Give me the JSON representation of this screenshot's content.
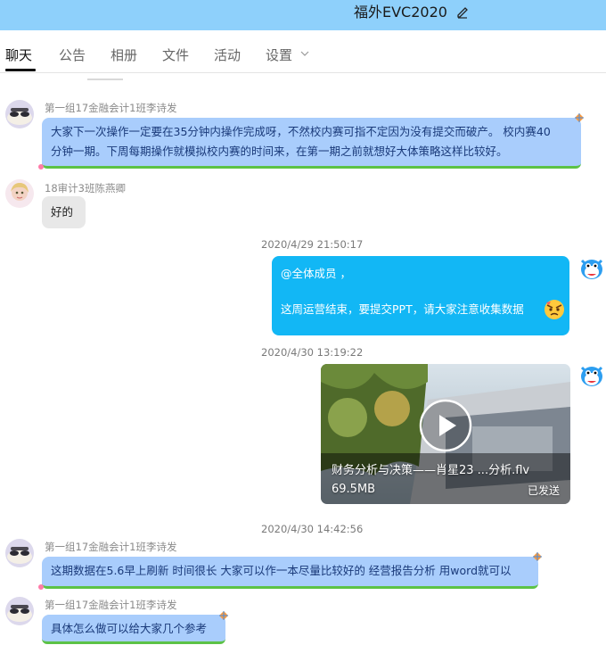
{
  "window": {
    "title": "福外EVC2020"
  },
  "tabs": [
    {
      "label": "聊天",
      "active": true
    },
    {
      "label": "公告"
    },
    {
      "label": "相册"
    },
    {
      "label": "文件"
    },
    {
      "label": "活动"
    },
    {
      "label": "设置"
    }
  ],
  "messages": {
    "m1": {
      "sender": "第一组17金融会计1班李诗发",
      "line1": "大家下一次操作一定要在35分钟内操作完成呀，不然校内赛可指不定因为没有提交而破产。 校内赛40",
      "line2": "分钟一期。下周每期操作就模拟校内赛的时间来，在第一期之前就想好大体策略这样比较好。"
    },
    "m2": {
      "sender": "18审计3班陈燕卿",
      "text": "好的"
    },
    "m3": {
      "timestamp": "2020/4/29 21:50:17",
      "line1": "@全体成员 ，",
      "line2": "这周运营结束，要提交PPT，请大家注意收集数据"
    },
    "m4": {
      "timestamp": "2020/4/30 13:19:22",
      "video_title": "财务分析与决策——肖星23 ...分析.flv",
      "video_size": "69.5MB",
      "video_status": "已发送"
    },
    "m5": {
      "timestamp": "2020/4/30 14:42:56",
      "sender": "第一组17金融会计1班李诗发",
      "text": "这期数据在5.6早上刷新 时间很长 大家可以作一本尽量比较好的 经营报告分析 用word就可以"
    },
    "m6": {
      "sender": "第一组17金融会计1班李诗发",
      "text": "具体怎么做可以给大家几个参考"
    }
  },
  "colors": {
    "titlebar": "#8ed0fb",
    "bubble_blue": "#a9cdfc",
    "bubble_self": "#12b7f5",
    "bubble_gray": "#e8e8e8",
    "bubble_accent": "#5cc246"
  },
  "icons": {
    "edit": "edit-icon",
    "dropdown": "chevron-down-icon",
    "play": "play-icon",
    "decoration": "kite-icon",
    "emoji": "emoji-angry-icon"
  }
}
